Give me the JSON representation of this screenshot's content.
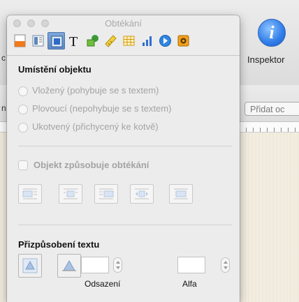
{
  "background": {
    "inspector_label": "Inspektor",
    "add_button_label": "Přidat oc",
    "cut_letter_top": "c",
    "cut_letter_mid": "n"
  },
  "panel": {
    "title": "Obtékání",
    "tabs": [
      {
        "icon": "document-icon",
        "selected": false
      },
      {
        "icon": "layout-icon",
        "selected": false
      },
      {
        "icon": "wrap-icon",
        "selected": true
      },
      {
        "icon": "text-icon",
        "selected": false
      },
      {
        "icon": "graphic-icon",
        "selected": false
      },
      {
        "icon": "metrics-icon",
        "selected": false
      },
      {
        "icon": "table-icon",
        "selected": false
      },
      {
        "icon": "chart-icon",
        "selected": false
      },
      {
        "icon": "link-icon",
        "selected": false
      },
      {
        "icon": "quicktime-icon",
        "selected": false
      }
    ],
    "placement": {
      "title": "Umístění objektu",
      "options": [
        "Vložený (pohybuje se s textem)",
        "Plovoucí (nepohybuje se s textem)",
        "Ukotvený (přichycený ke kotvě)"
      ]
    },
    "wrap": {
      "checkbox_label": "Objekt způsobuje obtékání",
      "checked": false
    },
    "text_fit": {
      "title": "Přizpůsobení textu",
      "offset_label": "Odsazení",
      "offset_value": "",
      "alpha_label": "Alfa",
      "alpha_value": ""
    }
  },
  "colors": {
    "selected_tab": "#5d88c3",
    "disabled_text": "#a3a3a3"
  }
}
